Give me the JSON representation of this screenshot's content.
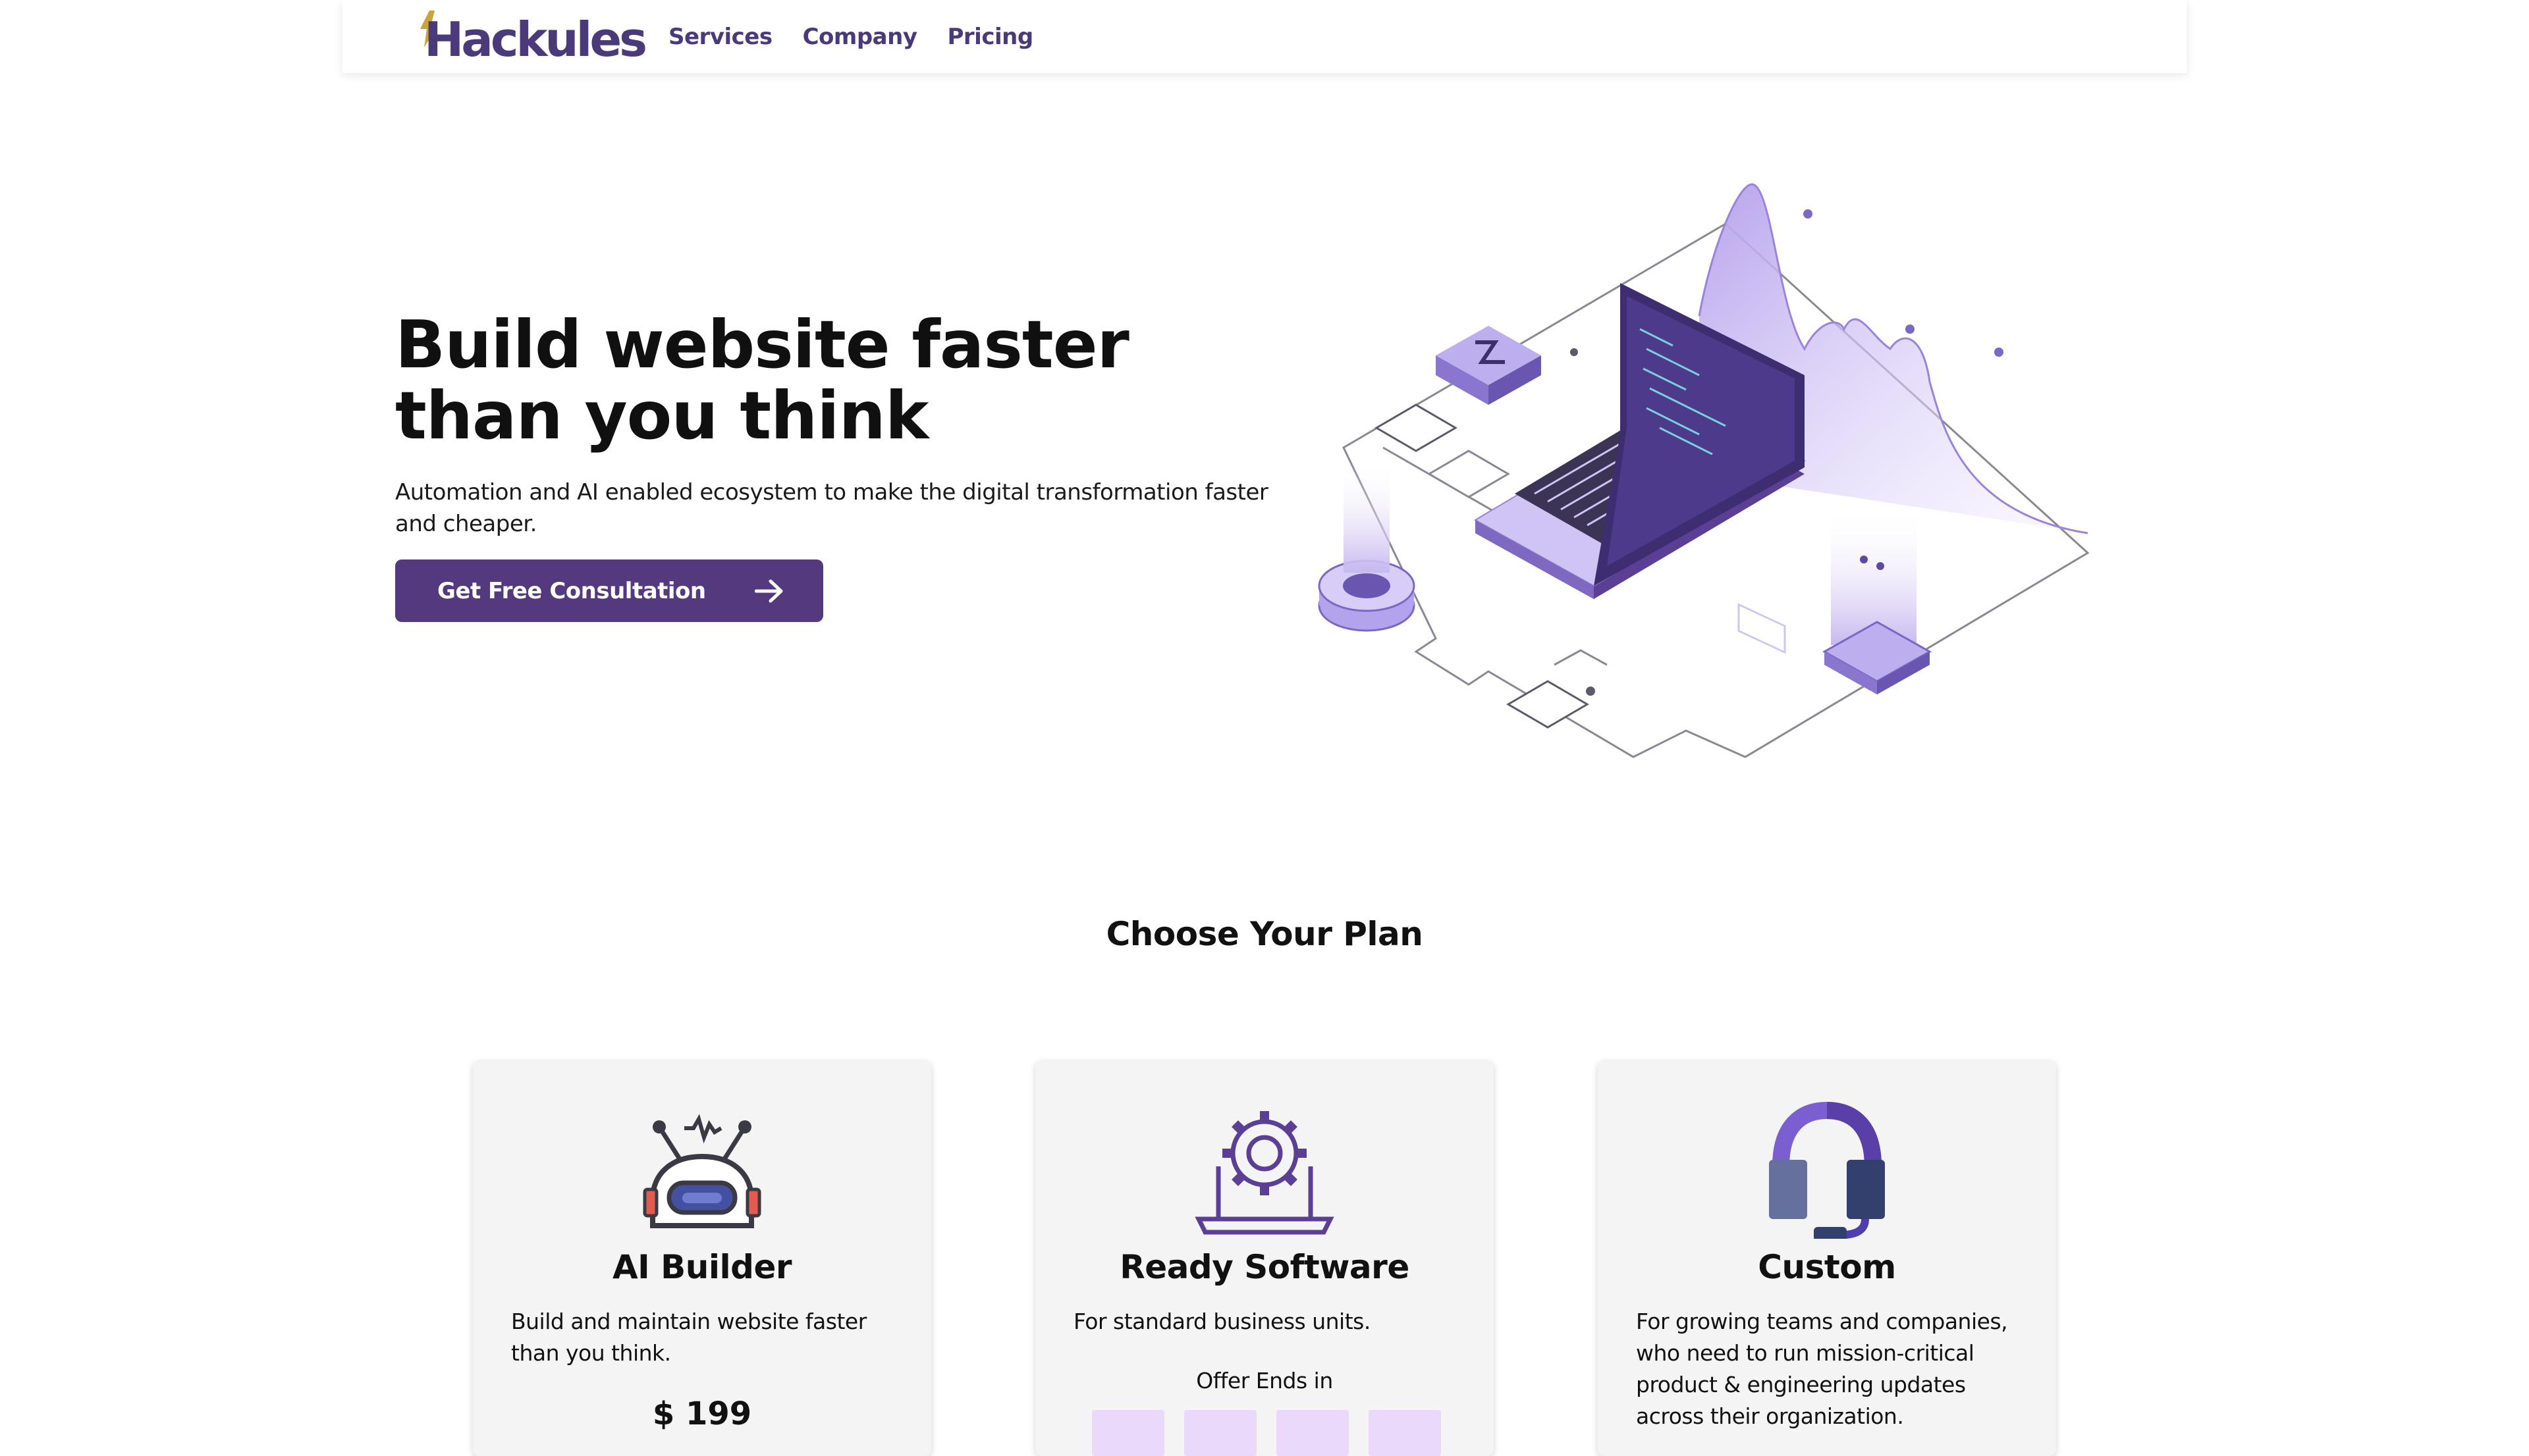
{
  "brand": {
    "name": "Hackules",
    "primary": "#55397f",
    "logo_purple": "#4b3a7a",
    "logo_gold": "#c9a43a"
  },
  "nav": {
    "items": [
      {
        "label": "Services"
      },
      {
        "label": "Company"
      },
      {
        "label": "Pricing"
      }
    ]
  },
  "hero": {
    "title": "Build website faster than you think",
    "subtitle": "Automation and AI enabled ecosystem to make the digital transformation faster and cheaper.",
    "cta_label": "Get Free Consultation",
    "cta_icon": "arrow-right-icon"
  },
  "plans": {
    "title": "Choose Your Plan",
    "cards": [
      {
        "icon": "robot-icon",
        "title": "AI Builder",
        "description": "Build and maintain website faster than you think.",
        "price": "$ 199"
      },
      {
        "icon": "gear-laptop-icon",
        "title": "Ready Software",
        "description": "For standard business units.",
        "offer_label": "Offer Ends in"
      },
      {
        "icon": "headset-icon",
        "title": "Custom",
        "description": "For growing teams and companies, who need to run mission-critical product & engineering updates across their organization."
      }
    ]
  }
}
